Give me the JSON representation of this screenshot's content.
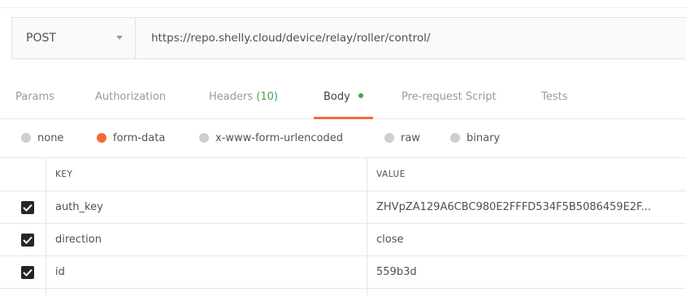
{
  "request": {
    "method": "POST",
    "url": "https://repo.shelly.cloud/device/relay/roller/control/"
  },
  "tabs": [
    {
      "label": "Params"
    },
    {
      "label": "Authorization"
    },
    {
      "label": "Headers",
      "count": "(10)"
    },
    {
      "label": "Body",
      "active": true
    },
    {
      "label": "Pre-request Script"
    },
    {
      "label": "Tests"
    }
  ],
  "body_types": [
    {
      "label": "none"
    },
    {
      "label": "form-data",
      "selected": true
    },
    {
      "label": "x-www-form-urlencoded"
    },
    {
      "label": "raw"
    },
    {
      "label": "binary"
    }
  ],
  "table": {
    "headers": {
      "key": "KEY",
      "value": "VALUE"
    },
    "rows": [
      {
        "key": "auth_key",
        "value": "ZHVpZA129A6CBC980E2FFFD534F5B5086459E2F...",
        "checked": true
      },
      {
        "key": "direction",
        "value": "close",
        "checked": true
      },
      {
        "key": "id",
        "value": "559b3d",
        "checked": true
      }
    ]
  },
  "colors": {
    "accent": "#f26b3a",
    "success": "#48a447"
  }
}
